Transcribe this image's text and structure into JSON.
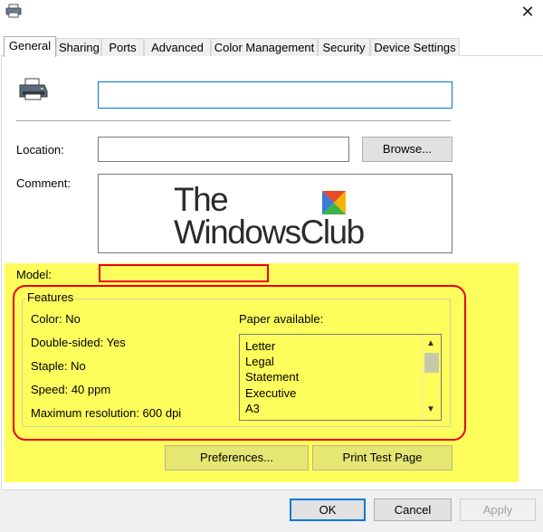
{
  "tabs": [
    {
      "label": "General"
    },
    {
      "label": "Sharing"
    },
    {
      "label": "Ports"
    },
    {
      "label": "Advanced"
    },
    {
      "label": "Color Management"
    },
    {
      "label": "Security"
    },
    {
      "label": "Device Settings"
    }
  ],
  "general": {
    "printer_name_value": "",
    "location_label": "Location:",
    "location_value": "",
    "browse_label": "Browse...",
    "comment_label": "Comment:",
    "comment_logo_line1": "The",
    "comment_logo_line2": "WindowsClub",
    "model_label": "Model:"
  },
  "features": {
    "legend": "Features",
    "color": "Color: No",
    "double_sided": "Double-sided: Yes",
    "staple": "Staple: No",
    "speed": "Speed: 40 ppm",
    "max_resolution": "Maximum resolution: 600 dpi",
    "paper_label": "Paper available:",
    "paper_options": [
      "Letter",
      "Legal",
      "Statement",
      "Executive",
      "A3"
    ]
  },
  "buttons": {
    "preferences": "Preferences...",
    "print_test": "Print Test Page",
    "ok": "OK",
    "cancel": "Cancel",
    "apply": "Apply"
  },
  "icons": {
    "title": "printer-icon",
    "close": "close-icon",
    "printer_large": "printer-icon",
    "logo_mark": "windows-club-logo-icon",
    "scroll_up": "chevron-up-icon",
    "scroll_down": "chevron-down-icon"
  },
  "colors": {
    "highlight": "#fdfd5c",
    "annotation_red": "#e8001a",
    "focus_blue": "#0078d7"
  }
}
